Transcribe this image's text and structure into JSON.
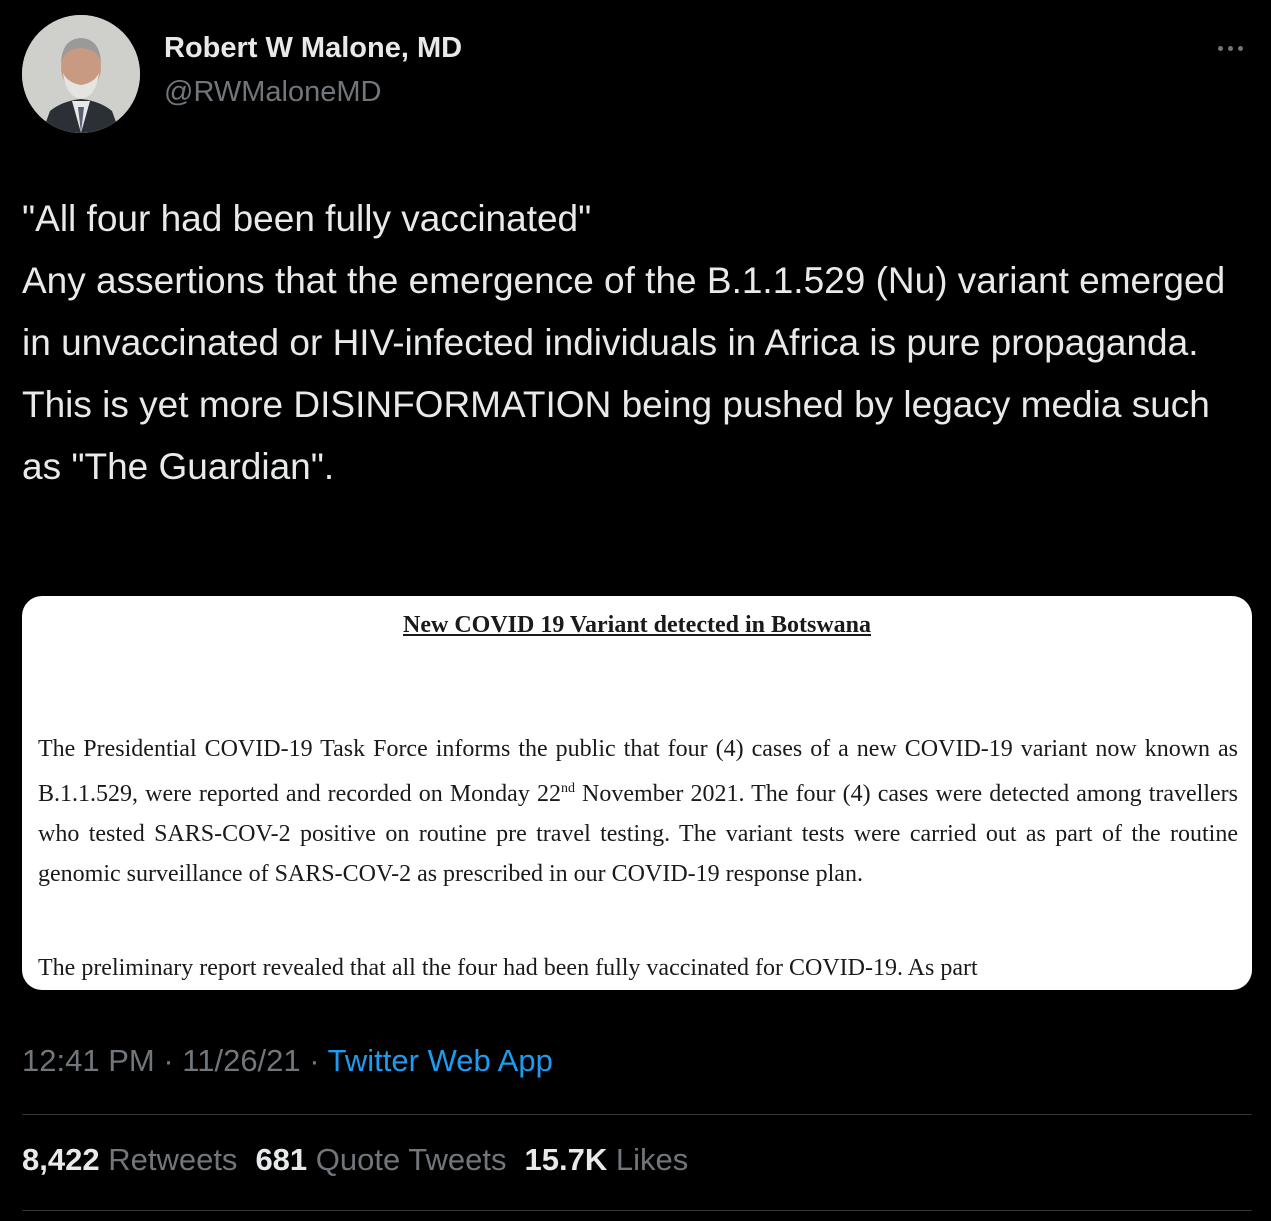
{
  "author": {
    "name": "Robert W Malone, MD",
    "handle": "@RWMaloneMD"
  },
  "tweet_text": "\"All four had been fully vaccinated\"\nAny assertions that the emergence of the B.1.1.529 (Nu) variant emerged in unvaccinated or HIV-infected individuals in Africa is pure propaganda.  This is yet more DISINFORMATION being pushed by legacy media such as \"The Guardian\".",
  "media": {
    "title": "New COVID 19 Variant detected in Botswana",
    "para1_before_sup": "The Presidential COVID-19 Task Force informs the public that four (4) cases of a new COVID-19 variant now known as B.1.1.529, were reported and recorded on Monday 22",
    "para1_sup": "nd",
    "para1_after_sup": " November 2021. The four (4) cases were detected among travellers who tested SARS-COV-2 positive on routine pre travel testing. The variant tests were carried out as part of the routine genomic surveillance of SARS-COV-2 as prescribed in our COVID-19 response plan.",
    "para2": "The preliminary report revealed that all the four had been fully vaccinated for COVID-19. As part"
  },
  "meta": {
    "time": "12:41 PM",
    "date": "11/26/21",
    "separator": "·",
    "app": "Twitter Web App"
  },
  "stats": {
    "retweets_count": "8,422",
    "retweets_label": "Retweets",
    "quotes_count": "681",
    "quotes_label": "Quote Tweets",
    "likes_count": "15.7K",
    "likes_label": "Likes"
  },
  "icons": {
    "more": "more-horizontal-icon",
    "avatar": "profile-photo"
  }
}
